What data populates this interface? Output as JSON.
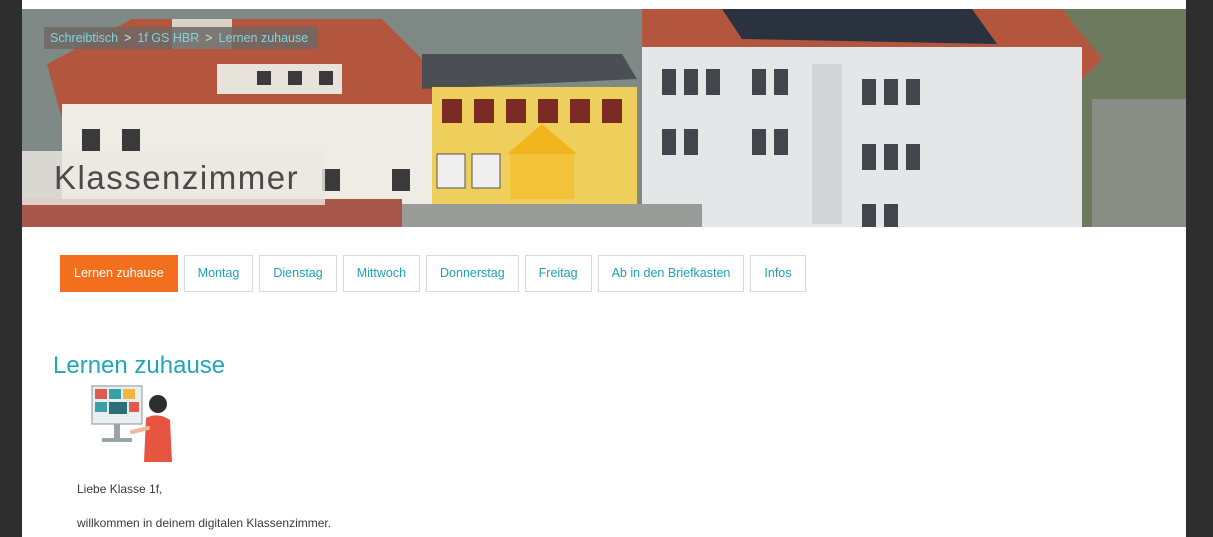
{
  "breadcrumb": {
    "items": [
      "Schreibtisch",
      "1f GS HBR",
      "Lernen zuhause"
    ],
    "separator": ">"
  },
  "header": {
    "title": "Klassenzimmer"
  },
  "tabs": [
    {
      "label": "Lernen zuhause",
      "active": true
    },
    {
      "label": "Montag",
      "active": false
    },
    {
      "label": "Dienstag",
      "active": false
    },
    {
      "label": "Mittwoch",
      "active": false
    },
    {
      "label": "Donnerstag",
      "active": false
    },
    {
      "label": "Freitag",
      "active": false
    },
    {
      "label": "Ab in den Briefkasten",
      "active": false
    },
    {
      "label": "Infos",
      "active": false
    }
  ],
  "content": {
    "title": "Lernen zuhause",
    "paragraphs": [
      "Liebe Klasse 1f,",
      "willkommen in deinem digitalen Klassenzimmer."
    ]
  },
  "colors": {
    "accent": "#1fa7b8",
    "active_tab": "#f26f1e"
  }
}
